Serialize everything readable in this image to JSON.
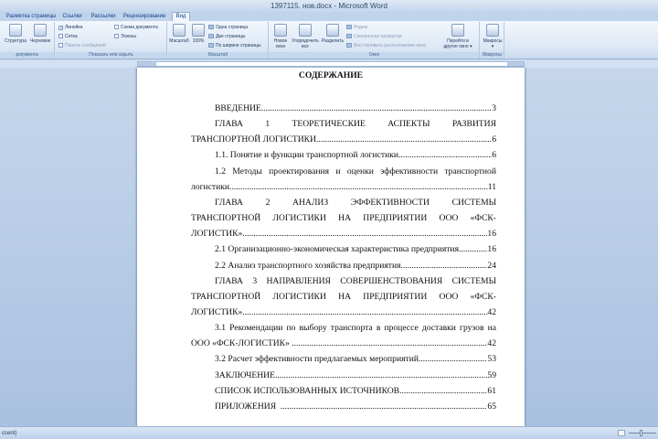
{
  "window": {
    "title": "1397115. нов.docx - Microsoft Word"
  },
  "tabs": [
    {
      "label": "Разметка страницы",
      "active": false
    },
    {
      "label": "Ссылки",
      "active": false
    },
    {
      "label": "Рассылки",
      "active": false
    },
    {
      "label": "Рецензирование",
      "active": false
    },
    {
      "label": "Вид",
      "active": true
    }
  ],
  "ribbon": {
    "doc_views": {
      "structure": "Структура",
      "draft": "Черновик",
      "group_label": "документа"
    },
    "show_hide": {
      "ruler": "Линейка",
      "grid": "Сетка",
      "message_bar": "Панель сообщений",
      "doc_map": "Схема документа",
      "thumbnails": "Эскизы",
      "group_label": "Показать или скрыть"
    },
    "zoom": {
      "zoom_btn": "Масштаб",
      "pct_btn": "100%",
      "one_page": "Одна страница",
      "two_pages": "Две страницы",
      "page_width": "По ширине страницы",
      "group_label": "Масштаб"
    },
    "window": {
      "new_window": [
        "Новое",
        "окно"
      ],
      "arrange_all": [
        "Упорядочить",
        "все"
      ],
      "split": "Разделить",
      "side_by_side": "Рядом",
      "sync_scroll": "Синхронная прокрутка",
      "reset_pos": "Восстановить расположение окна",
      "switch": [
        "Перейти в",
        "другое окно ▾"
      ],
      "group_label": "Окно"
    },
    "macros": {
      "macros_btn": [
        "Макросы",
        "▾"
      ],
      "group_label": "Макросы"
    }
  },
  "document": {
    "heading": "СОДЕРЖАНИЕ",
    "toc": [
      {
        "type": "lead",
        "indent": true,
        "text": "ВВЕДЕНИЕ",
        "page": "3"
      },
      {
        "type": "just",
        "indent": true,
        "words": [
          "ГЛАВА",
          "1",
          "ТЕОРЕТИЧЕСКИЕ",
          "АСПЕКТЫ",
          "РАЗВИТИЯ"
        ]
      },
      {
        "type": "lead",
        "indent": false,
        "text": "ТРАНСПОРТНОЙ ЛОГИСТИКИ",
        "page": "6"
      },
      {
        "type": "lead",
        "indent": true,
        "text": "1.1. Понятие и функции транспортной логистики",
        "page": "6"
      },
      {
        "type": "just",
        "indent": true,
        "words": [
          "1.2",
          "Методы",
          "проектирования",
          "и",
          "оценки",
          "эффективности",
          "транспортной"
        ]
      },
      {
        "type": "lead",
        "indent": false,
        "text": "логистики",
        "page": "11"
      },
      {
        "type": "just",
        "indent": true,
        "words": [
          "ГЛАВА",
          "2",
          "АНАЛИЗ",
          "ЭФФЕКТИВНОСТИ",
          "СИСТЕМЫ"
        ]
      },
      {
        "type": "just",
        "indent": false,
        "words": [
          "ТРАНСПОРТНОЙ",
          "ЛОГИСТИКИ",
          "НА",
          "ПРЕДПРИЯТИИ",
          "ООО",
          "«ФСК-"
        ]
      },
      {
        "type": "lead",
        "indent": false,
        "text": "ЛОГИСТИК»",
        "page": "16"
      },
      {
        "type": "lead",
        "indent": true,
        "text": "2.1 Организационно-экономическая характеристика предприятия",
        "page": "16"
      },
      {
        "type": "lead",
        "indent": true,
        "text": "2.2 Анализ транспортного хозяйства предприятия",
        "page": "24"
      },
      {
        "type": "just",
        "indent": true,
        "words": [
          "ГЛАВА",
          "3",
          "НАПРАВЛЕНИЯ",
          "СОВЕРШЕНСТВОВАНИЯ",
          "СИСТЕМЫ"
        ]
      },
      {
        "type": "just",
        "indent": false,
        "words": [
          "ТРАНСПОРТНОЙ",
          "ЛОГИСТИКИ",
          "НА",
          "ПРЕДПРИЯТИИ",
          "ООО",
          "«ФСК-"
        ]
      },
      {
        "type": "lead",
        "indent": false,
        "text": "ЛОГИСТИК»",
        "page": "42"
      },
      {
        "type": "just",
        "indent": true,
        "words": [
          "3.1",
          "Рекомендации",
          "по",
          "выбору",
          "транспорта",
          "в",
          "процессе",
          "доставки",
          "грузов",
          "на"
        ]
      },
      {
        "type": "lead",
        "indent": false,
        "text": "ООО «ФСК-ЛОГИСТИК» ",
        "page": "42"
      },
      {
        "type": "lead",
        "indent": true,
        "text": "3.2 Расчет эффективности предлагаемых мероприятий",
        "page": "53"
      },
      {
        "type": "lead",
        "indent": true,
        "text": "ЗАКЛЮЧЕНИЕ",
        "page": "59"
      },
      {
        "type": "lead",
        "indent": true,
        "text": "СПИСОК ИСПОЛЬЗОВАННЫХ ИСТОЧНИКОВ",
        "page": "61"
      },
      {
        "type": "lead",
        "indent": true,
        "text": "ПРИЛОЖЕНИЯ  ",
        "page": "65"
      }
    ]
  },
  "status": {
    "left_text": "ccent)"
  }
}
